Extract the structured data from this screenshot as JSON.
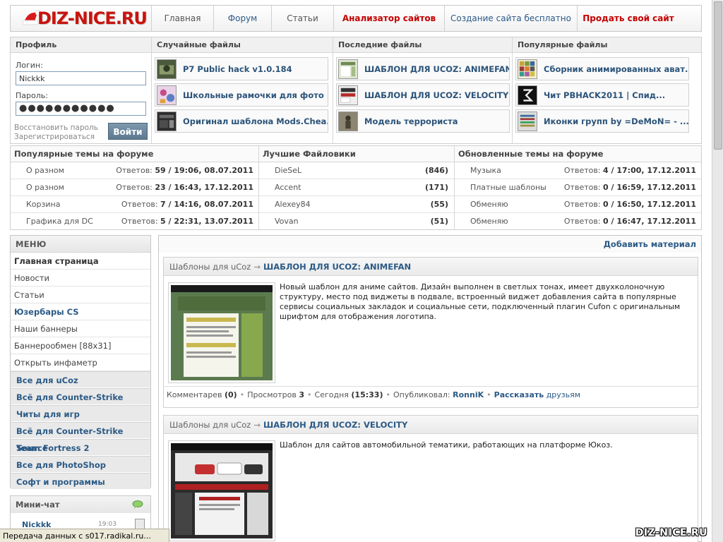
{
  "header": {
    "logo": "DIZ-NICE.RU",
    "nav": [
      {
        "label": "Главная"
      },
      {
        "label": "Форум"
      },
      {
        "label": "Статьи"
      },
      {
        "label": "Анализатор сайтов"
      },
      {
        "label": "Создание сайта бесплатно"
      },
      {
        "label": "Продать свой сайт"
      }
    ]
  },
  "profile": {
    "title": "Профиль",
    "login_label": "Логин:",
    "login_value": "Nickkk",
    "password_label": "Пароль:",
    "password_value": "●●●●●●●●●●●",
    "restore_link": "Восстановить пароль",
    "register_link": "Зарегистрироваться",
    "login_button": "Войти"
  },
  "files": {
    "random": {
      "title": "Случайные файлы",
      "items": [
        "P7 Public hack v1.0.184",
        "Школьные рамочки для фото ...",
        "Оригинал шаблона Mods.Chea..."
      ]
    },
    "latest": {
      "title": "Последние файлы",
      "items": [
        "ШАБЛОН ДЛЯ UCOZ: ANIMEFAN",
        "ШАБЛОН ДЛЯ UCOZ: VELOCITY",
        "Модель террориста"
      ]
    },
    "popular": {
      "title": "Популярные файлы",
      "items": [
        "Сборник анимированных ават...",
        "Чит PBHACK2011 | Спид...",
        "Иконки групп by =DeMoN= - ..."
      ]
    }
  },
  "forum": {
    "popular": {
      "title": "Популярные темы на форуме",
      "rows": [
        {
          "name": "О разном",
          "prefix": "Ответов:",
          "stats": "59 / 19:06, 08.07.2011"
        },
        {
          "name": "О разном",
          "prefix": "Ответов:",
          "stats": "23 / 16:43, 17.12.2011"
        },
        {
          "name": "Корзина",
          "prefix": "Ответов:",
          "stats": "7 / 14:16, 08.07.2011"
        },
        {
          "name": "Графика для DC",
          "prefix": "Ответов:",
          "stats": "5 / 22:31, 13.07.2011"
        }
      ]
    },
    "best": {
      "title": "Лучшие Файловики",
      "rows": [
        {
          "name": "DieSeL",
          "count": "(846)"
        },
        {
          "name": "Accent",
          "count": "(171)"
        },
        {
          "name": "Alexey84",
          "count": "(55)"
        },
        {
          "name": "Vovan",
          "count": "(51)"
        }
      ]
    },
    "updated": {
      "title": "Обновленные темы на форуме",
      "rows": [
        {
          "name": "Музыка",
          "prefix": "Ответов:",
          "stats": "4 / 17:00, 17.12.2011"
        },
        {
          "name": "Платные шаблоны",
          "prefix": "Ответов:",
          "stats": "0 / 16:59, 17.12.2011"
        },
        {
          "name": "Обменяю",
          "prefix": "Ответов:",
          "stats": "0 / 16:50, 17.12.2011"
        },
        {
          "name": "Обменяю",
          "prefix": "Ответов:",
          "stats": "0 / 16:47, 17.12.2011"
        }
      ]
    }
  },
  "menu": {
    "title": "МЕНЮ",
    "items": [
      "Главная страница",
      "Новости",
      "Статьи",
      "Юзербары CS",
      "Наши баннеры",
      "Баннерообмен [88x31]",
      "Открыть инфаметр",
      "Все для uCoz",
      "Всё для Counter-Strike",
      "Читы для игр",
      "Всё для Counter-Strike Source",
      "Team Fortress 2",
      "Все для PhotoShop",
      "Софт и программы"
    ]
  },
  "chat": {
    "title": "Мини-чат",
    "user": "Nickkk",
    "time": "19:03"
  },
  "main": {
    "add_material": "Добавить материал",
    "posts": [
      {
        "category": "Шаблоны для uCoz",
        "arrow": "→",
        "title": "ШАБЛОН ДЛЯ UCOZ: ANIMEFAN",
        "text": "Новый шаблон для аниме сайтов. Дизайн выполнен в светлых тонах, имеет двухколоночную структуру, место под виджеты в подвале, встроенный виджет добавления сайта в популярные сервисы социальных закладок и социальные сети, подключенный плагин Cufon с оригинальным шрифтом для отображения логотипа.",
        "comments_label": "Комментарев",
        "comments": "(0)",
        "views_label": "Просмотров",
        "views": "3",
        "date_label": "Сегодня",
        "date": "(15:33)",
        "author_label": "Опубликовал:",
        "author": "RonniK",
        "share": "Рассказать",
        "share2": "друзьям"
      },
      {
        "category": "Шаблоны для uCoz",
        "arrow": "→",
        "title": "ШАБЛОН ДЛЯ UCOZ: VELOCITY",
        "text": "Шаблон для сайтов автомобильной тематики, работающих на платформе Юкоз."
      }
    ]
  },
  "statusbar": "Передача данных с s017.radikal.ru...",
  "watermark": "DIZ-NICE.RU"
}
